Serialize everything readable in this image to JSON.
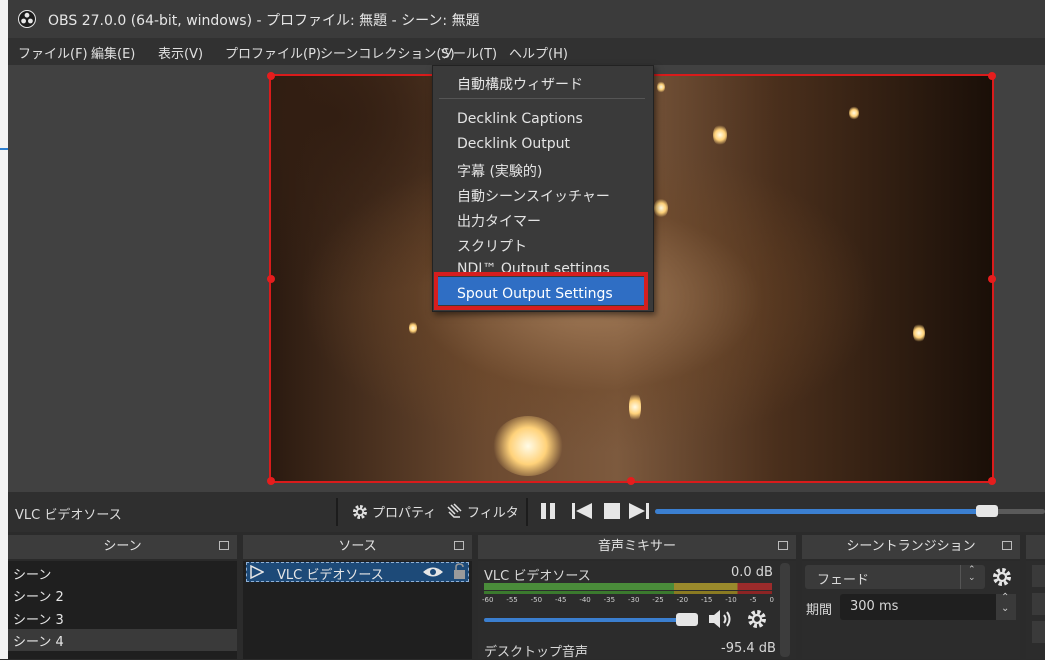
{
  "window": {
    "title": "OBS 27.0.0 (64-bit, windows) - プロファイル: 無題 - シーン: 無題"
  },
  "menu": [
    {
      "label": "ファイル(F)"
    },
    {
      "label": "編集(E)"
    },
    {
      "label": "表示(V)"
    },
    {
      "label": "プロファイル(P)"
    },
    {
      "label": "シーンコレクション(S)"
    },
    {
      "label": "ツール(T)"
    },
    {
      "label": "ヘルプ(H)"
    }
  ],
  "tools_menu": {
    "items": [
      {
        "label": "自動構成ウィザード"
      },
      {
        "label": "Decklink Captions"
      },
      {
        "label": "Decklink Output"
      },
      {
        "label": "字幕 (実験的)"
      },
      {
        "label": "自動シーンスイッチャー"
      },
      {
        "label": "出力タイマー"
      },
      {
        "label": "スクリプト"
      },
      {
        "label": "NDI™ Output settings"
      },
      {
        "label": "Spout Output Settings"
      }
    ],
    "highlighted": "Spout Output Settings"
  },
  "controls": {
    "source_label": "VLC ビデオソース",
    "properties_label": "プロパティ",
    "filters_label": "フィルタ",
    "seek_progress": 0.85
  },
  "docks": {
    "scenes": {
      "title": "シーン",
      "items": [
        "シーン",
        "シーン 2",
        "シーン 3",
        "シーン 4"
      ],
      "selected": "シーン 4"
    },
    "sources": {
      "title": "ソース",
      "items": [
        "VLC ビデオソース"
      ]
    },
    "mixer": {
      "title": "音声ミキサー",
      "channels": [
        {
          "name": "VLC ビデオソース",
          "level": "0.0 dB"
        },
        {
          "name": "デスクトップ音声",
          "level": "-95.4 dB"
        }
      ],
      "scale": [
        "-60",
        "-55",
        "-50",
        "-45",
        "-40",
        "-35",
        "-30",
        "-25",
        "-20",
        "-15",
        "-10",
        "-5",
        "0"
      ]
    },
    "transitions": {
      "title": "シーントランジション",
      "type": "フェード",
      "duration_label": "期間",
      "duration": "300 ms"
    }
  },
  "colors": {
    "accent": "#2f6ec4",
    "selection_red": "#d61e1e"
  }
}
